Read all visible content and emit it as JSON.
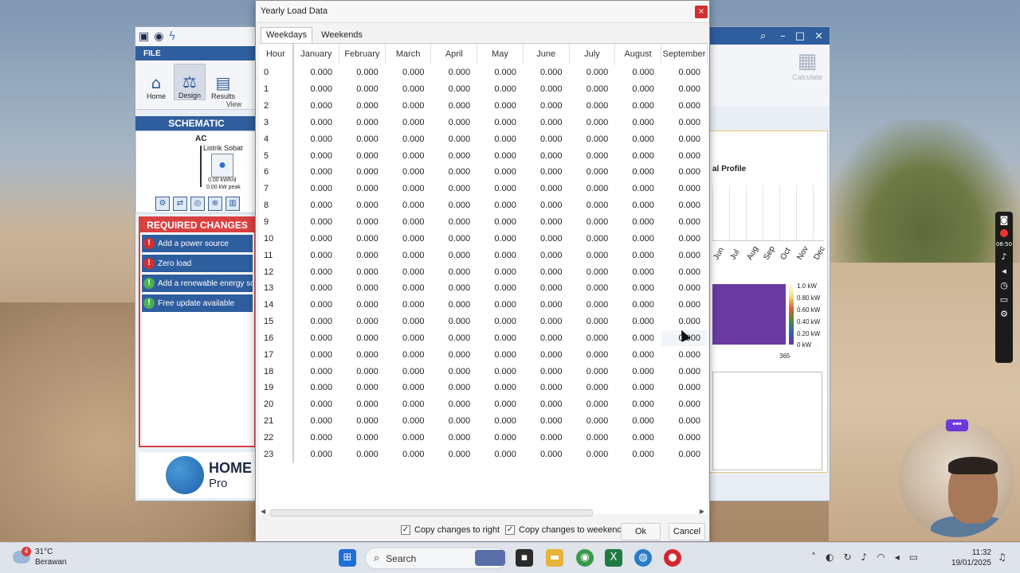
{
  "dialog": {
    "title": "Yearly Load Data",
    "close_glyph": "×",
    "tabs": [
      {
        "label": "Weekdays",
        "active": true
      },
      {
        "label": "Weekends",
        "active": false
      }
    ],
    "columns": [
      "Hour",
      "January",
      "February",
      "March",
      "April",
      "May",
      "June",
      "July",
      "August",
      "September"
    ],
    "rows": [
      {
        "hour": "0",
        "values": [
          "0.000",
          "0.000",
          "0.000",
          "0.000",
          "0.000",
          "0.000",
          "0.000",
          "0.000",
          "0.000"
        ]
      },
      {
        "hour": "1",
        "values": [
          "0.000",
          "0.000",
          "0.000",
          "0.000",
          "0.000",
          "0.000",
          "0.000",
          "0.000",
          "0.000"
        ]
      },
      {
        "hour": "2",
        "values": [
          "0.000",
          "0.000",
          "0.000",
          "0.000",
          "0.000",
          "0.000",
          "0.000",
          "0.000",
          "0.000"
        ]
      },
      {
        "hour": "3",
        "values": [
          "0.000",
          "0.000",
          "0.000",
          "0.000",
          "0.000",
          "0.000",
          "0.000",
          "0.000",
          "0.000"
        ]
      },
      {
        "hour": "4",
        "values": [
          "0.000",
          "0.000",
          "0.000",
          "0.000",
          "0.000",
          "0.000",
          "0.000",
          "0.000",
          "0.000"
        ]
      },
      {
        "hour": "5",
        "values": [
          "0.000",
          "0.000",
          "0.000",
          "0.000",
          "0.000",
          "0.000",
          "0.000",
          "0.000",
          "0.000"
        ]
      },
      {
        "hour": "6",
        "values": [
          "0.000",
          "0.000",
          "0.000",
          "0.000",
          "0.000",
          "0.000",
          "0.000",
          "0.000",
          "0.000"
        ]
      },
      {
        "hour": "7",
        "values": [
          "0.000",
          "0.000",
          "0.000",
          "0.000",
          "0.000",
          "0.000",
          "0.000",
          "0.000",
          "0.000"
        ]
      },
      {
        "hour": "8",
        "values": [
          "0.000",
          "0.000",
          "0.000",
          "0.000",
          "0.000",
          "0.000",
          "0.000",
          "0.000",
          "0.000"
        ]
      },
      {
        "hour": "9",
        "values": [
          "0.000",
          "0.000",
          "0.000",
          "0.000",
          "0.000",
          "0.000",
          "0.000",
          "0.000",
          "0.000"
        ]
      },
      {
        "hour": "10",
        "values": [
          "0.000",
          "0.000",
          "0.000",
          "0.000",
          "0.000",
          "0.000",
          "0.000",
          "0.000",
          "0.000"
        ]
      },
      {
        "hour": "11",
        "values": [
          "0.000",
          "0.000",
          "0.000",
          "0.000",
          "0.000",
          "0.000",
          "0.000",
          "0.000",
          "0.000"
        ]
      },
      {
        "hour": "12",
        "values": [
          "0.000",
          "0.000",
          "0.000",
          "0.000",
          "0.000",
          "0.000",
          "0.000",
          "0.000",
          "0.000"
        ]
      },
      {
        "hour": "13",
        "values": [
          "0.000",
          "0.000",
          "0.000",
          "0.000",
          "0.000",
          "0.000",
          "0.000",
          "0.000",
          "0.000"
        ]
      },
      {
        "hour": "14",
        "values": [
          "0.000",
          "0.000",
          "0.000",
          "0.000",
          "0.000",
          "0.000",
          "0.000",
          "0.000",
          "0.000"
        ]
      },
      {
        "hour": "15",
        "values": [
          "0.000",
          "0.000",
          "0.000",
          "0.000",
          "0.000",
          "0.000",
          "0.000",
          "0.000",
          "0.000"
        ]
      },
      {
        "hour": "16",
        "values": [
          "0.000",
          "0.000",
          "0.000",
          "0.000",
          "0.000",
          "0.000",
          "0.000",
          "0.000",
          "0.000"
        ]
      },
      {
        "hour": "17",
        "values": [
          "0.000",
          "0.000",
          "0.000",
          "0.000",
          "0.000",
          "0.000",
          "0.000",
          "0.000",
          "0.000"
        ]
      },
      {
        "hour": "18",
        "values": [
          "0.000",
          "0.000",
          "0.000",
          "0.000",
          "0.000",
          "0.000",
          "0.000",
          "0.000",
          "0.000"
        ]
      },
      {
        "hour": "19",
        "values": [
          "0.000",
          "0.000",
          "0.000",
          "0.000",
          "0.000",
          "0.000",
          "0.000",
          "0.000",
          "0.000"
        ]
      },
      {
        "hour": "20",
        "values": [
          "0.000",
          "0.000",
          "0.000",
          "0.000",
          "0.000",
          "0.000",
          "0.000",
          "0.000",
          "0.000"
        ]
      },
      {
        "hour": "21",
        "values": [
          "0.000",
          "0.000",
          "0.000",
          "0.000",
          "0.000",
          "0.000",
          "0.000",
          "0.000",
          "0.000"
        ]
      },
      {
        "hour": "22",
        "values": [
          "0.000",
          "0.000",
          "0.000",
          "0.000",
          "0.000",
          "0.000",
          "0.000",
          "0.000",
          "0.000"
        ]
      },
      {
        "hour": "23",
        "values": [
          "0.000",
          "0.000",
          "0.000",
          "0.000",
          "0.000",
          "0.000",
          "0.000",
          "0.000",
          "0.000"
        ]
      }
    ],
    "footer": {
      "copy_right_label": "Copy changes to right",
      "copy_right_checked": true,
      "copy_weekend_label": "Copy changes to weekend",
      "copy_weekend_checked": true,
      "ok_label": "Ok",
      "cancel_label": "Cancel"
    }
  },
  "homer": {
    "file_label": "FILE",
    "ribbon": [
      {
        "label": "Home",
        "icon": "home-icon"
      },
      {
        "label": "Design",
        "icon": "design-icon"
      },
      {
        "label": "Results",
        "icon": "results-icon"
      }
    ],
    "ribbon_group": "View",
    "schematic_title": "SCHEMATIC",
    "schematic_ac": "AC",
    "load_name": "Listrik Sobat",
    "load_kwh": "0.00 kWh/d",
    "load_kw": "0.00 kW peak",
    "required_title": "REQUIRED CHANGES",
    "required_items": [
      {
        "label": "Add a power source",
        "status": "red"
      },
      {
        "label": "Zero load",
        "status": "red"
      },
      {
        "label": "Add a renewable energy source",
        "status": "green"
      },
      {
        "label": "Free update available",
        "status": "green"
      }
    ],
    "logo_main": "HOME",
    "logo_sub": "Pro",
    "calculate_label": "Calculate",
    "profile_label": "al Profile",
    "months": [
      "Jun",
      "Jul",
      "Aug",
      "Sep",
      "Oct",
      "Nov",
      "Dec"
    ],
    "scale_labels": [
      "1.0 kW",
      "0.80 kW",
      "0.60 kW",
      "0.40 kW",
      "0.20 kW",
      "0 kW"
    ],
    "axis_end": "365"
  },
  "taskbar": {
    "weather_temp": "31°C",
    "weather_desc": "Berawan",
    "weather_badge": "4",
    "search_label": "Search",
    "time": "11:32",
    "date": "19/01/2025"
  },
  "overlay": {
    "rail_time": "08:50",
    "badge": "•••"
  }
}
